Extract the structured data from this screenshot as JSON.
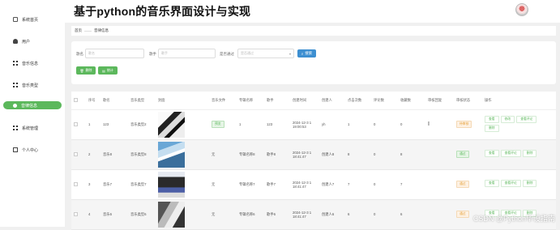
{
  "app": {
    "title": "基于python的音乐界面设计与实现"
  },
  "sidebar": {
    "items": [
      {
        "label": "系统首页",
        "icon": "home-icon"
      },
      {
        "label": "用户",
        "icon": "user-icon"
      },
      {
        "label": "音乐信息",
        "icon": "grid-icon"
      },
      {
        "label": "音乐类型",
        "icon": "grid-icon"
      },
      {
        "label": "音律信息",
        "icon": "circle-icon",
        "active": true
      },
      {
        "label": "系统管理",
        "icon": "grid-icon"
      },
      {
        "label": "个人中心",
        "icon": "person-icon"
      }
    ]
  },
  "breadcrumb": {
    "home": "首页",
    "current": "音律信息"
  },
  "search": {
    "label1": "歌名",
    "placeholder1": "歌名",
    "label2": "歌手",
    "placeholder2": "歌手",
    "label3": "是否通过",
    "placeholder3": "是否通过",
    "search_button": "搜索",
    "delete_button": "删除",
    "stats_button": "统计"
  },
  "table": {
    "headers": [
      "",
      "序号",
      "歌名",
      "音乐类型",
      "封面",
      "音乐文件",
      "专辑名称",
      "歌手",
      "创建时间",
      "创建人",
      "点击次数",
      "评论数",
      "收藏数",
      "审核回复",
      "审核状态",
      "操作"
    ],
    "rows": [
      {
        "index": "1",
        "name": "123",
        "type": "音乐类型2",
        "file": "预览",
        "album": "1",
        "singer": "123",
        "time": "2024-12-3 1 19:00:53",
        "creator": "yh",
        "clicks": "1",
        "comments": "0",
        "favorites": "0",
        "reply": "",
        "status": "待审核",
        "ops": [
          "查看",
          "修改",
          "查看评论",
          "删除"
        ]
      },
      {
        "index": "2",
        "name": "音乐8",
        "type": "音乐类型8",
        "file": "无",
        "album": "专辑名称8",
        "singer": "歌手8",
        "time": "2024-12-3 1 18:41:47",
        "creator": "创建人8",
        "clicks": "8",
        "comments": "0",
        "favorites": "8",
        "reply": "",
        "status": "通过",
        "ops": [
          "查看",
          "查看评论",
          "删除"
        ]
      },
      {
        "index": "3",
        "name": "音乐7",
        "type": "音乐类型7",
        "file": "无",
        "album": "专辑名称7",
        "singer": "歌手7",
        "time": "2024-12-3 1 18:41:47",
        "creator": "创建人7",
        "clicks": "7",
        "comments": "0",
        "favorites": "7",
        "reply": "",
        "status": "通过",
        "ops": [
          "查看",
          "查看评论",
          "删除"
        ]
      },
      {
        "index": "4",
        "name": "音乐6",
        "type": "音乐类型6",
        "file": "无",
        "album": "专辑名称6",
        "singer": "歌手6",
        "time": "2024-12-3 1 18:41:47",
        "creator": "创建人6",
        "clicks": "6",
        "comments": "0",
        "favorites": "6",
        "reply": "",
        "status": "通过",
        "ops": [
          "查看",
          "查看评论",
          "删除"
        ]
      }
    ]
  },
  "watermark": "CSDN @Python毕设指南"
}
